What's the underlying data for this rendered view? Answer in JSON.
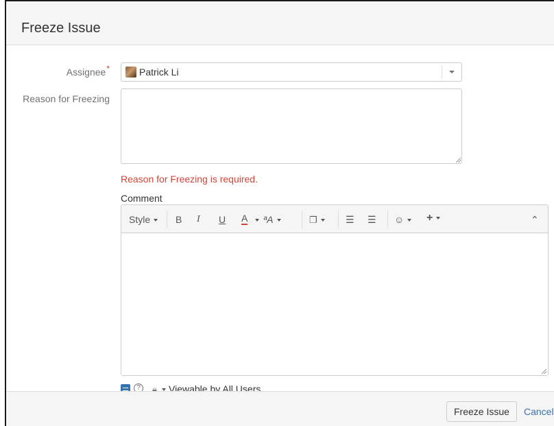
{
  "dialog": {
    "title": "Freeze Issue"
  },
  "form": {
    "assignee": {
      "label": "Assignee",
      "required_marker": "*",
      "value": "Patrick Li"
    },
    "reason": {
      "label": "Reason for Freezing",
      "value": "",
      "error": "Reason for Freezing is required."
    },
    "comment": {
      "label": "Comment",
      "toolbar": {
        "style": "Style",
        "bold": "B",
        "italic": "I",
        "underline": "U",
        "text_color": "A",
        "more_format": "ªA",
        "link": "🔗",
        "bullet_list": "☷",
        "numbered_list": "☷",
        "emoticon": "☺",
        "insert": "+",
        "collapse": "⌃"
      },
      "value": ""
    },
    "footer_tools": {
      "visibility": "Viewable by All Users"
    }
  },
  "buttons": {
    "submit": "Freeze Issue",
    "cancel": "Cancel"
  },
  "icons": {
    "avatar": "user-avatar",
    "help": "help-icon",
    "lock": "lock-icon",
    "wiki": "wiki-markup-icon"
  },
  "colors": {
    "error": "#d04437",
    "link": "#3572b0",
    "header_bg": "#f5f5f5"
  }
}
